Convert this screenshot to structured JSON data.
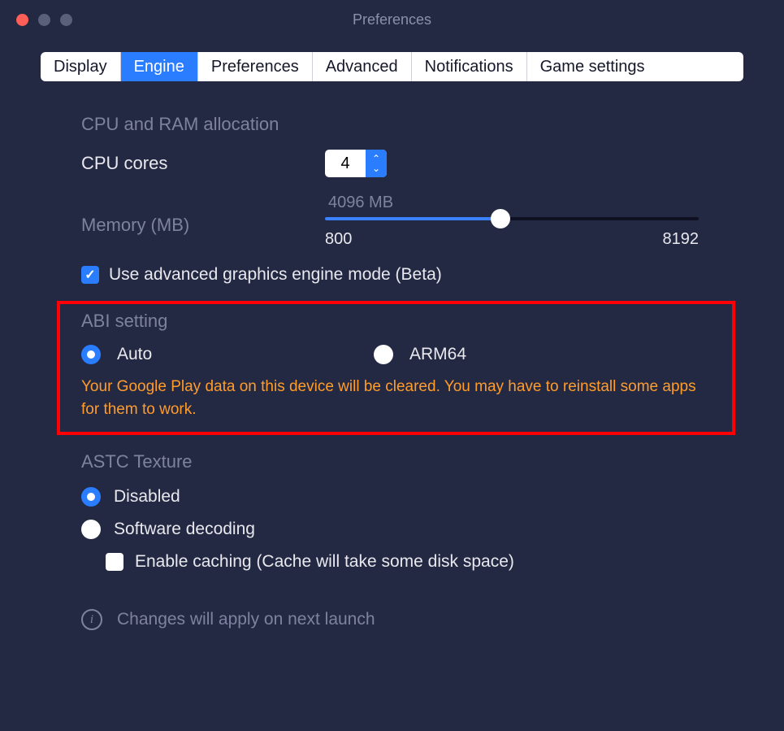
{
  "window": {
    "title": "Preferences"
  },
  "tabs": [
    {
      "label": "Display",
      "active": false
    },
    {
      "label": "Engine",
      "active": true
    },
    {
      "label": "Preferences",
      "active": false
    },
    {
      "label": "Advanced",
      "active": false
    },
    {
      "label": "Notifications",
      "active": false
    },
    {
      "label": "Game settings",
      "active": false
    }
  ],
  "cpuRam": {
    "section_title": "CPU and RAM allocation",
    "cores_label": "CPU cores",
    "cores_value": "4",
    "memory_label": "Memory (MB)",
    "memory_value": "4096 MB",
    "memory_min": "800",
    "memory_max": "8192",
    "advanced_gfx_label": "Use advanced graphics engine mode (Beta)"
  },
  "abi": {
    "section_title": "ABI setting",
    "option_auto": "Auto",
    "option_arm64": "ARM64",
    "warning": "Your Google Play data on this device will be cleared. You may have to reinstall some apps for them to work."
  },
  "astc": {
    "section_title": "ASTC Texture",
    "option_disabled": "Disabled",
    "option_software": "Software decoding",
    "caching_label": "Enable caching (Cache will take some disk space)"
  },
  "footer": {
    "note": "Changes will apply on next launch"
  }
}
